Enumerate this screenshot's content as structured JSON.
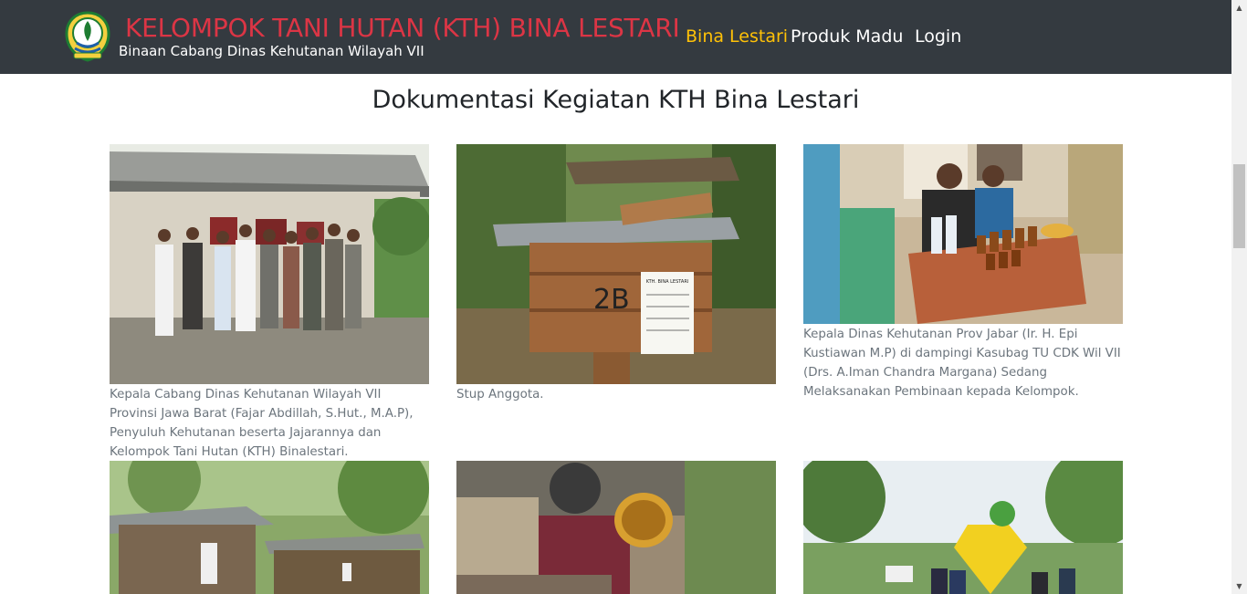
{
  "header": {
    "title": "KELOMPOK TANI HUTAN (KTH) BINA LESTARI",
    "subtitle": "Binaan Cabang Dinas Kehutanan Wilayah VII",
    "nav": [
      {
        "label": "Bina Lestari",
        "active": true
      },
      {
        "label": "Produk Madu",
        "active": false
      },
      {
        "label": "Login",
        "active": false
      }
    ]
  },
  "main": {
    "heading": "Dokumentasi Kegiatan KTH Bina Lestari",
    "gallery": [
      {
        "caption": "Kepala Cabang Dinas Kehutanan Wilayah VII Provinsi Jawa Barat (Fajar Abdillah, S.Hut., M.A.P), Penyuluh Kehutanan beserta Jajarannya dan Kelompok Tani Hutan (KTH) Binalestari."
      },
      {
        "caption": "Stup Anggota.",
        "label_text": "KTH. BINA LESTARI",
        "number": "2B"
      },
      {
        "caption": "Kepala Dinas Kehutanan Prov Jabar (Ir. H. Epi Kustiawan M.P) di dampingi Kasubag TU CDK Wil VII (Drs. A.Iman Chandra Margana) Sedang Melaksanakan Pembinaan kepada Kelompok."
      },
      {
        "caption": ""
      },
      {
        "caption": ""
      },
      {
        "caption": ""
      }
    ]
  },
  "colors": {
    "navbar_bg": "#343a40",
    "brand_red": "#dc3545",
    "active_link": "#ffc107",
    "caption_gray": "#6c757d"
  }
}
